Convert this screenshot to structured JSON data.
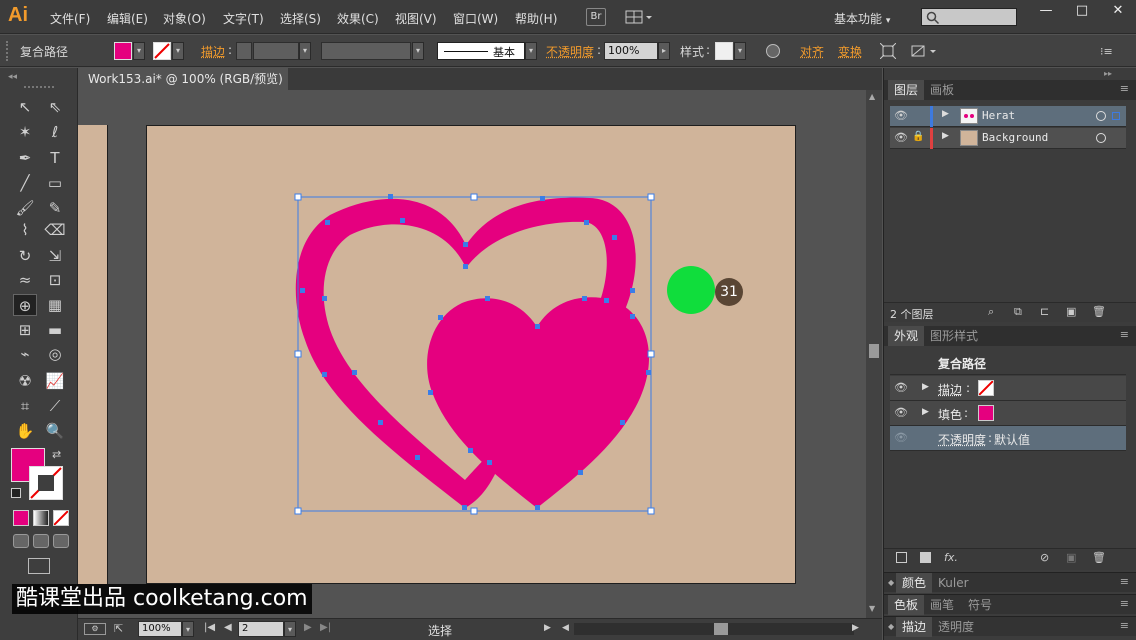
{
  "app": {
    "logo": "Ai"
  },
  "menu": [
    "文件(F)",
    "编辑(E)",
    "对象(O)",
    "文字(T)",
    "选择(S)",
    "效果(C)",
    "视图(V)",
    "窗口(W)",
    "帮助(H)"
  ],
  "bridge_label": "Br",
  "workspace": "基本功能",
  "window_controls": [
    "—",
    "□",
    "✕"
  ],
  "control_bar": {
    "object_type": "复合路径",
    "stroke_label": "描边",
    "stroke_style": "基本",
    "opacity_label": "不透明度",
    "opacity_value": "100%",
    "style_label": "样式",
    "align_label": "对齐",
    "transform_label": "变换",
    "fill_color": "#e5007f"
  },
  "document": {
    "tab_title": "Work153.ai* @ 100% (RGB/预览)"
  },
  "status_bar": {
    "zoom": "100%",
    "page": "2",
    "tool": "选择"
  },
  "layers_panel": {
    "tabs": [
      "图层",
      "画板"
    ],
    "layers": [
      {
        "name": "Herat",
        "color": "#3d7ae0",
        "selected": true
      },
      {
        "name": "Background",
        "color": "#e04040",
        "selected": false
      }
    ],
    "count_label": "2 个图层"
  },
  "appearance_panel": {
    "tabs": [
      "外观",
      "图形样式"
    ],
    "title": "复合路径",
    "stroke_label": "描边",
    "fill_label": "填色",
    "opacity_label": "不透明度",
    "opacity_value": "默认值"
  },
  "bottom_panels": [
    {
      "tabs": [
        "颜色",
        "Kuler"
      ]
    },
    {
      "tabs": [
        "色板",
        "画笔",
        "符号"
      ]
    },
    {
      "tabs": [
        "描边",
        "透明度"
      ]
    }
  ],
  "badge_number": "31",
  "watermark": "酷课堂出品 coolketang.com",
  "colors": {
    "accent": "#f29b2c",
    "heart_fill": "#e5007f",
    "artboard": "#d0b49a",
    "selection": "#3a7de8"
  }
}
